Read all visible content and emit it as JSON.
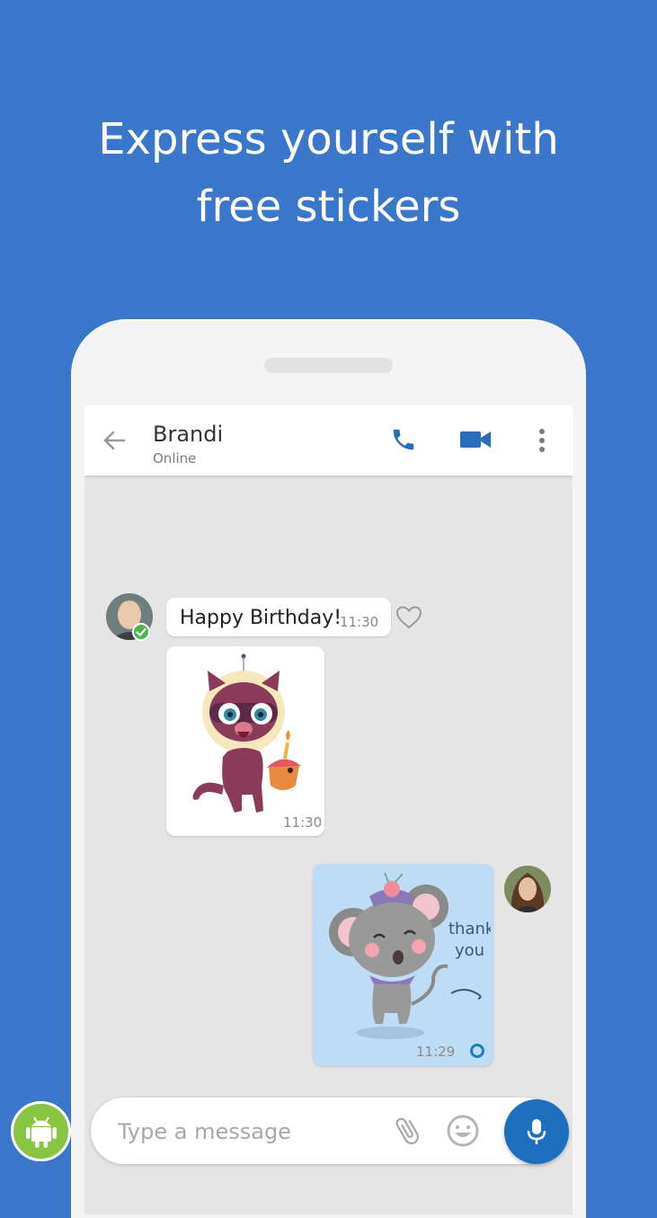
{
  "headline": {
    "line1": "Express yourself with",
    "line2": "free stickers"
  },
  "chat_header": {
    "contact_name": "Brandi",
    "contact_status": "Online",
    "icons": [
      "back-arrow-icon",
      "phone-icon",
      "video-camera-icon",
      "more-vert-icon"
    ]
  },
  "messages": [
    {
      "type": "text",
      "text": "Happy Birthday!",
      "time": "11:30",
      "direction": "incoming"
    },
    {
      "type": "sticker",
      "sticker": "cat-with-cupcake-sticker",
      "time": "11:30",
      "direction": "incoming"
    },
    {
      "type": "sticker",
      "sticker": "mouse-thank-you-sticker",
      "sticker_text_1": "thank",
      "sticker_text_2": "you",
      "time": "11:29",
      "direction": "outgoing"
    }
  ],
  "composer": {
    "placeholder": "Type a message",
    "icons": [
      "paperclip-icon",
      "emoji-icon",
      "microphone-icon"
    ]
  },
  "colors": {
    "background": "#3a76c9",
    "accent": "#1d6fbd",
    "outgoing_bubble": "#bfdcf6",
    "online_check": "#46b64a"
  }
}
